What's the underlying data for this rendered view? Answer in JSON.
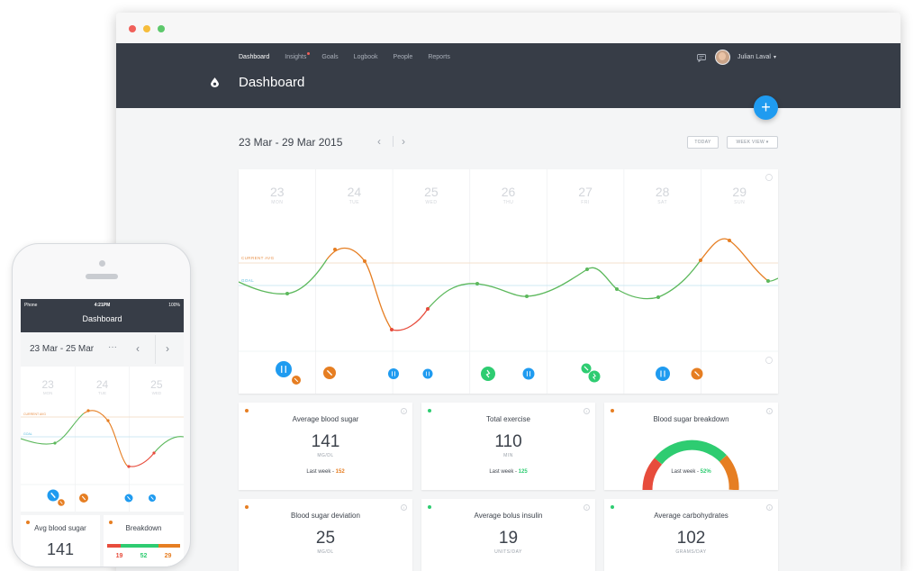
{
  "colors": {
    "accent": "#1f9bf0",
    "header": "#373d47",
    "green": "#4caf50",
    "orange": "#e67e22",
    "red": "#e74c3c"
  },
  "nav": {
    "items": [
      {
        "label": "Dashboard",
        "active": true
      },
      {
        "label": "Insights",
        "badge": true
      },
      {
        "label": "Goals"
      },
      {
        "label": "Logbook"
      },
      {
        "label": "People"
      },
      {
        "label": "Reports"
      }
    ]
  },
  "header": {
    "title": "Dashboard",
    "user_name": "Julian Laval"
  },
  "toolbar": {
    "date_range": "23 Mar - 29 Mar 2015",
    "today_label": "TODAY",
    "week_view_label": "WEEK VIEW"
  },
  "week": {
    "days": [
      {
        "num": "23",
        "name": "MON"
      },
      {
        "num": "24",
        "name": "TUE"
      },
      {
        "num": "25",
        "name": "WED"
      },
      {
        "num": "26",
        "name": "THU"
      },
      {
        "num": "27",
        "name": "FRI"
      },
      {
        "num": "28",
        "name": "SAT"
      },
      {
        "num": "29",
        "name": "SUN"
      }
    ],
    "current_avg_label": "CURRENT AVG",
    "goal_label": "GOAL"
  },
  "cards": [
    {
      "title": "Average blood sugar",
      "value": "141",
      "unit": "MG/DL",
      "last_label": "Last week - ",
      "last_value": "152",
      "dot": "#e67e22",
      "last_color": "#e67e22"
    },
    {
      "title": "Total exercise",
      "value": "110",
      "unit": "MIN",
      "last_label": "Last week - ",
      "last_value": "125",
      "dot": "#2ecc71",
      "last_color": "#2ecc71"
    },
    {
      "title": "Blood sugar breakdown",
      "last_label": "Last week - ",
      "last_value": "52%",
      "dot": "#e67e22",
      "last_color": "#2ecc71"
    },
    {
      "title": "Blood sugar deviation",
      "value": "25",
      "unit": "MG/DL",
      "dot": "#e67e22"
    },
    {
      "title": "Average bolus insulin",
      "value": "19",
      "unit": "UNITS/DAY",
      "dot": "#2ecc71"
    },
    {
      "title": "Average carbohydrates",
      "value": "102",
      "unit": "GRAMS/DAY",
      "dot": "#2ecc71"
    }
  ],
  "phone": {
    "carrier": "Phone",
    "time": "4:21PM",
    "battery": "100%",
    "title": "Dashboard",
    "date_range": "23 Mar - 25 Mar",
    "more": "···",
    "days": [
      {
        "num": "23",
        "name": "MON"
      },
      {
        "num": "24",
        "name": "TUE"
      },
      {
        "num": "25",
        "name": "WED"
      }
    ],
    "current_avg_label": "CURRENT AVG",
    "goal_label": "GOAL",
    "card1": {
      "title": "Avg blood sugar",
      "value": "141"
    },
    "card2": {
      "title": "Breakdown",
      "nums": [
        "19",
        "52",
        "29"
      ]
    }
  },
  "chart_data": {
    "type": "line",
    "title": "",
    "x": [
      "23",
      "24",
      "25",
      "26",
      "27",
      "28",
      "29"
    ],
    "series": [
      {
        "values": [
          130,
          185,
          90,
          150,
          170,
          155,
          195
        ]
      }
    ],
    "reference_lines": [
      {
        "name": "CURRENT AVG"
      },
      {
        "name": "GOAL"
      }
    ]
  }
}
